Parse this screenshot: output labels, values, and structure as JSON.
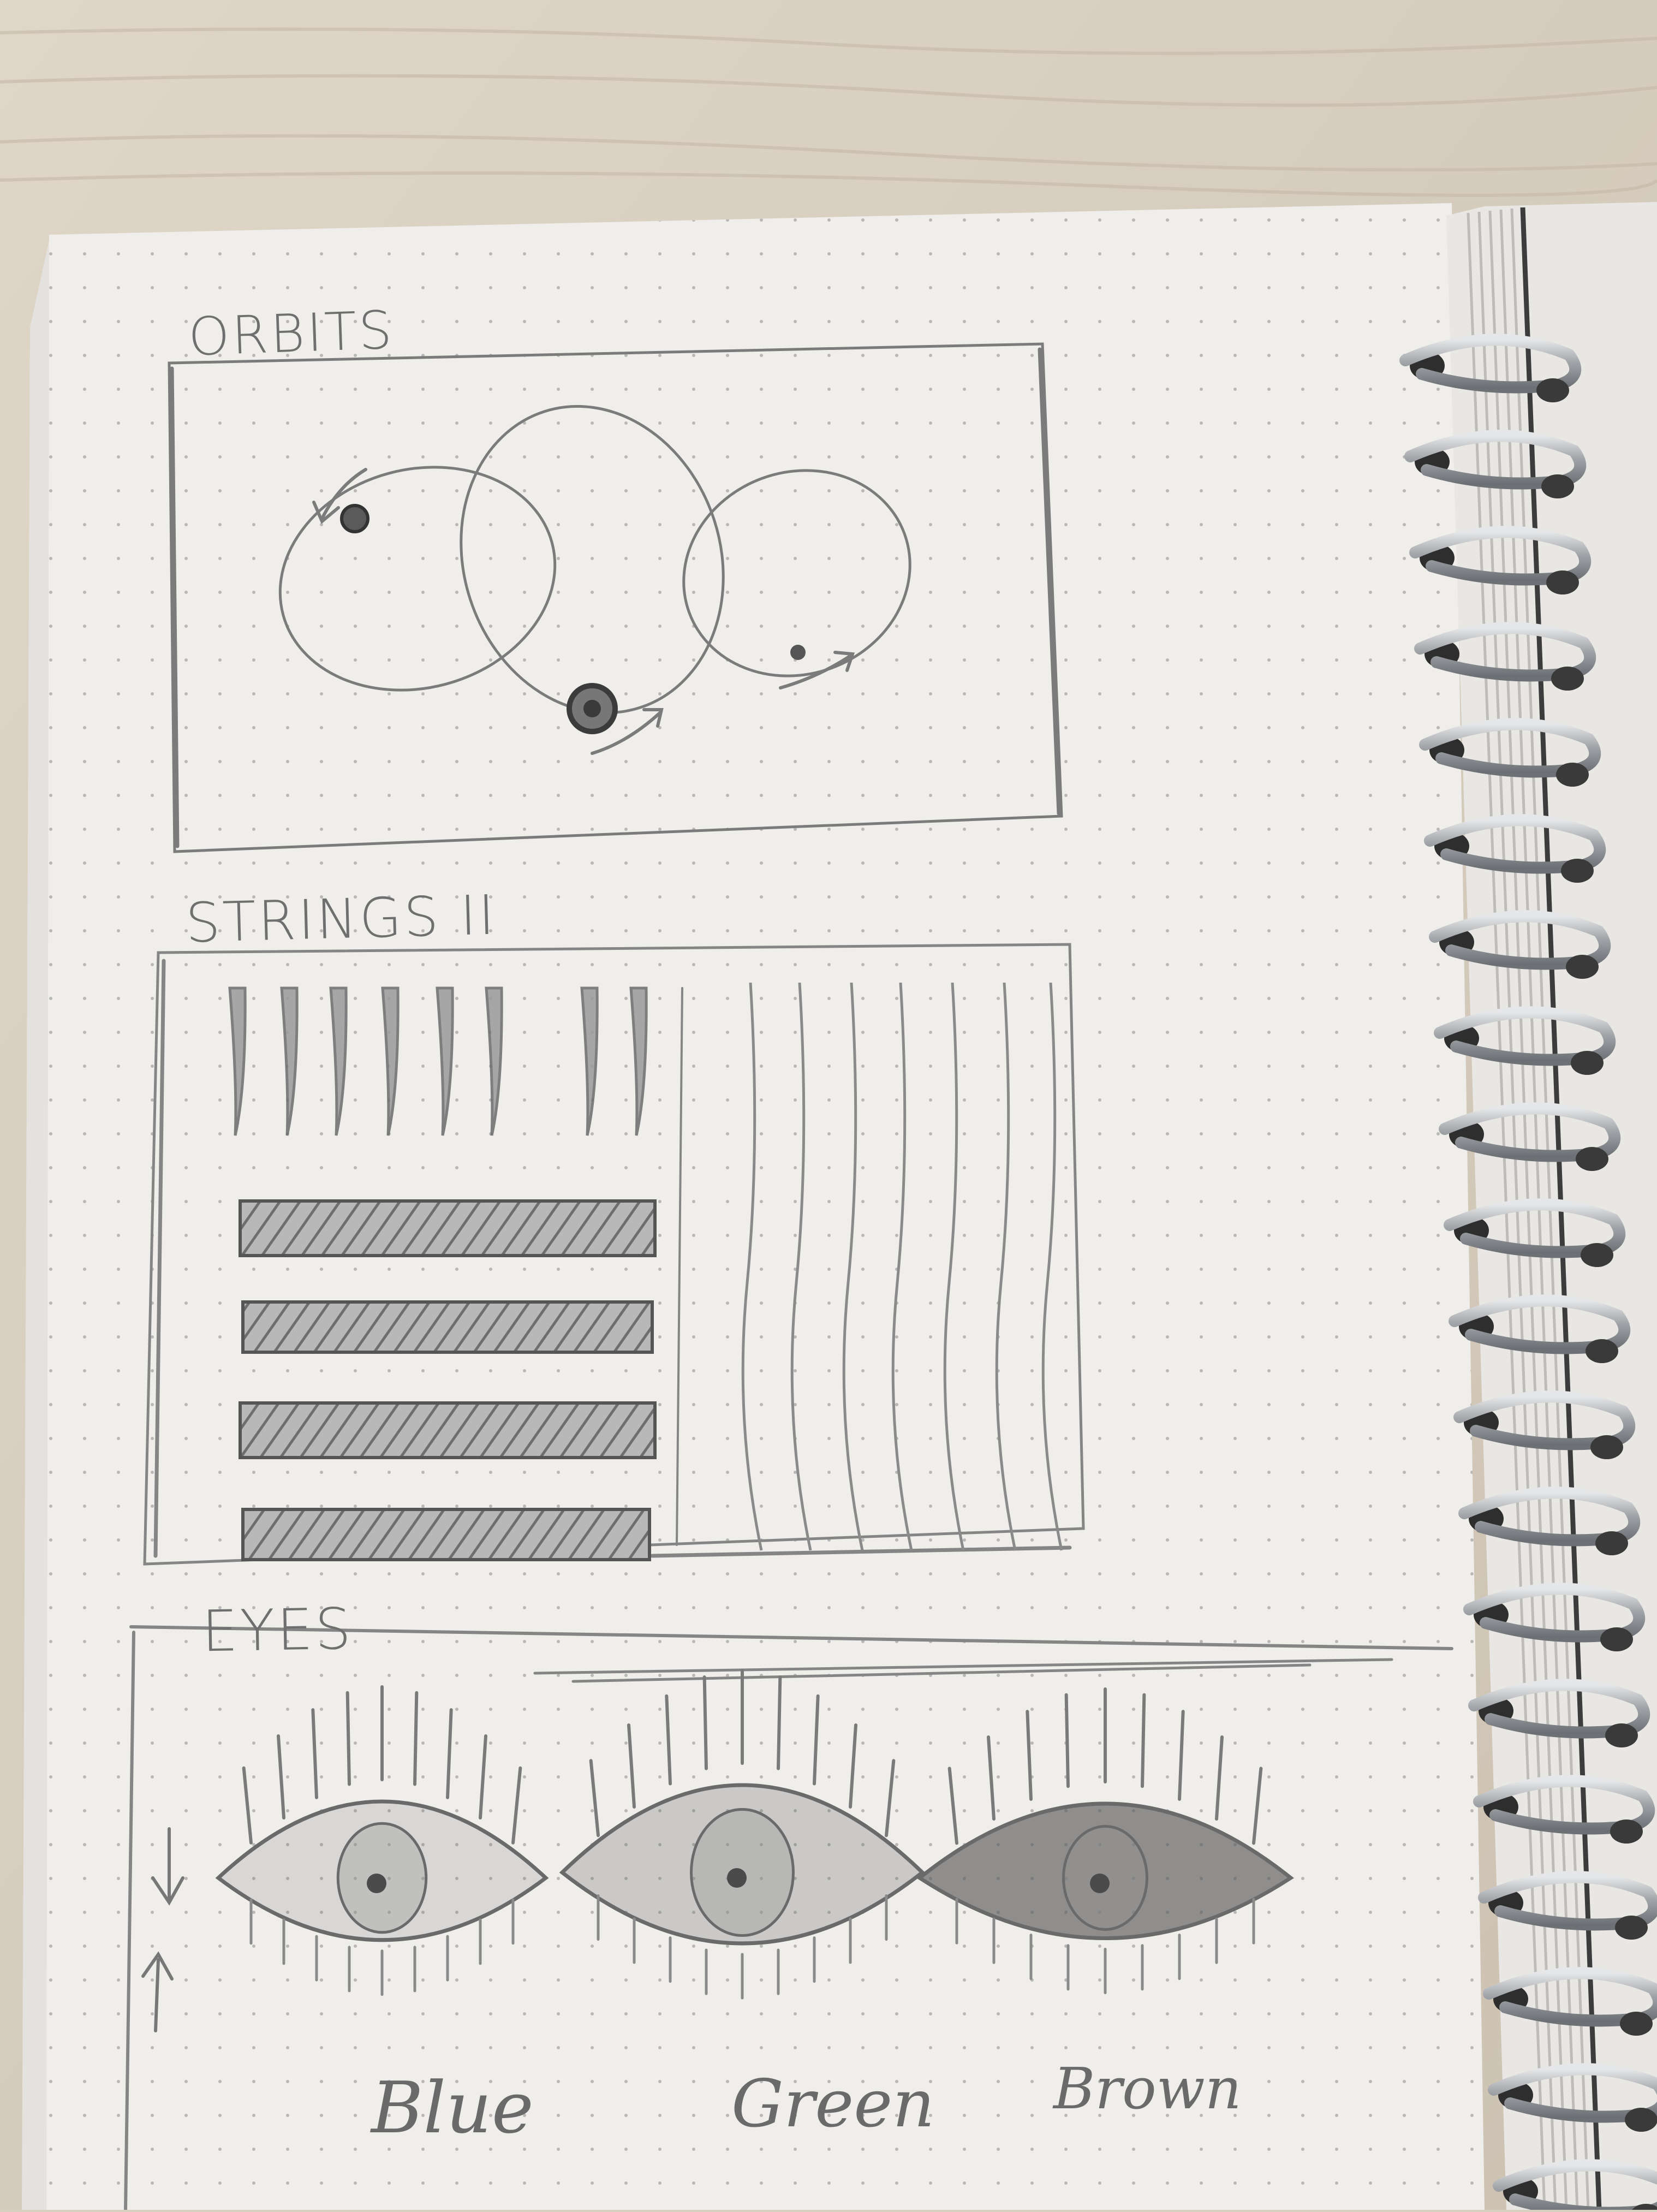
{
  "sections": [
    {
      "id": "orbits",
      "title": "ORBITS"
    },
    {
      "id": "strings",
      "title": "STRINGS II"
    },
    {
      "id": "eyes",
      "title": "EYES"
    }
  ],
  "eyes": {
    "captions": [
      "Blue",
      "Green",
      "Brown"
    ]
  },
  "colors": {
    "desk": "#d8cfc2",
    "paper": "#f1f0ed",
    "pencil": "#7a7a7a",
    "spiral": "#a8aaad"
  }
}
